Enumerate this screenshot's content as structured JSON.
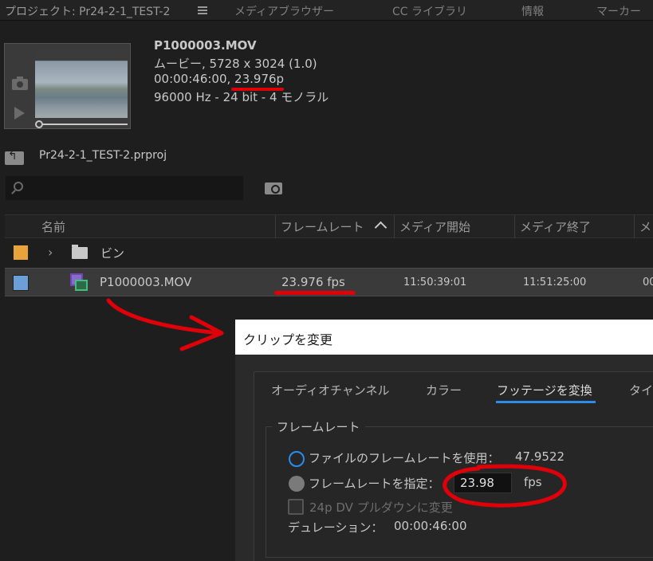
{
  "tabs": [
    {
      "label": "プロジェクト: Pr24-2-1_TEST-2"
    },
    {
      "label": "メディアブラウザー"
    },
    {
      "label": "CC ライブラリ"
    },
    {
      "label": "情報"
    },
    {
      "label": "マーカー"
    }
  ],
  "preview": {
    "filename": "P1000003.MOV",
    "line1": "ムービー, 5728 x 3024 (1.0)",
    "line2": "00:00:46:00, 23.976p",
    "line3": "96000 Hz - 24 bit - 4 モノラル"
  },
  "project": {
    "name": "Pr24-2-1_TEST-2.prproj"
  },
  "search": {
    "placeholder": ""
  },
  "table": {
    "headers": [
      "名前",
      "フレームレート",
      "メディア開始",
      "メディア終了",
      "メ"
    ],
    "rows": [
      {
        "swatch": "#e8a33d",
        "name": "ビン",
        "fps": "",
        "start": "",
        "end": "",
        "extra": ""
      },
      {
        "swatch": "#6a9fd8",
        "name": "P1000003.MOV",
        "fps": "23.976 fps",
        "start": "11:50:39:01",
        "end": "11:51:25:00",
        "extra": "00"
      }
    ]
  },
  "dialog": {
    "title": "クリップを変更",
    "tabs": [
      "オーディオチャンネル",
      "カラー",
      "フッテージを変換",
      "タイ"
    ],
    "active_tab": "フッテージを変換",
    "section": "フレームレート",
    "use_file_rate_label": "ファイルのフレームレートを使用：",
    "file_rate_value": "47.9522",
    "assume_rate_label": "フレームレートを指定：",
    "assume_rate_value": "23.98",
    "fps_unit": "fps",
    "pulldown_label": "24p DV プルダウンに変更",
    "duration_label": "デュレーション：",
    "duration_value": "00:00:46:00"
  },
  "colors": {
    "accent": "#2d8ceb",
    "annotation": "#e0000a"
  }
}
